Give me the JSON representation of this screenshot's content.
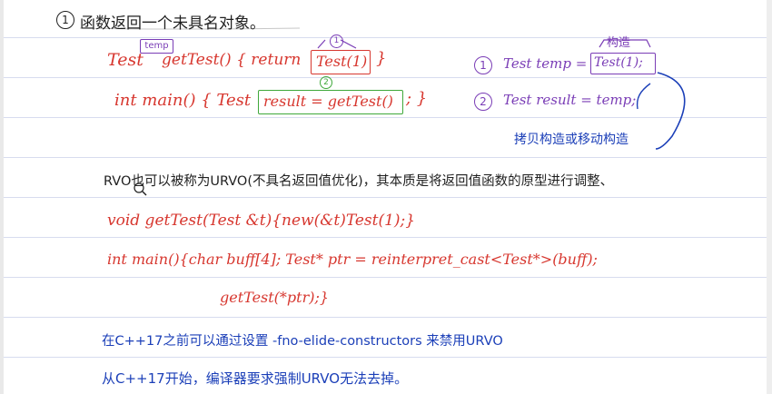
{
  "notes": {
    "heading": {
      "num": "1",
      "text": "函数返回一个未具名对象。"
    },
    "code1": {
      "part1": "Test",
      "temp_tag": "temp",
      "part2": "getTest() { return",
      "boxed": "Test(1)",
      "end": "}",
      "mark_num": "1"
    },
    "code2": {
      "part1": "int main() { Test",
      "boxed": "result = getTest()",
      "end": "; }",
      "mark_num": "2"
    },
    "side1": {
      "num": "1",
      "text": "Test temp =",
      "boxed": "Test(1);",
      "label": "构造"
    },
    "side2": {
      "num": "2",
      "text": "Test result = temp;"
    },
    "side_note": "拷贝构造或移动构造",
    "rvo_line": "RVO也可以被称为URVO(不具名返回值优化)，其本质是将返回值函数的原型进行调整、",
    "code3": "void getTest(Test &t){new(&t)Test(1);}",
    "code4": "int main(){char buff[4]; Test* ptr = reinterpret_cast<Test*>(buff);",
    "code5": "getTest(*ptr);}",
    "blue1": "在C++17之前可以通过设置 -fno-elide-constructors 来禁用URVO",
    "blue2": "从C++17开始，编译器要求强制URVO无法去掉。"
  }
}
